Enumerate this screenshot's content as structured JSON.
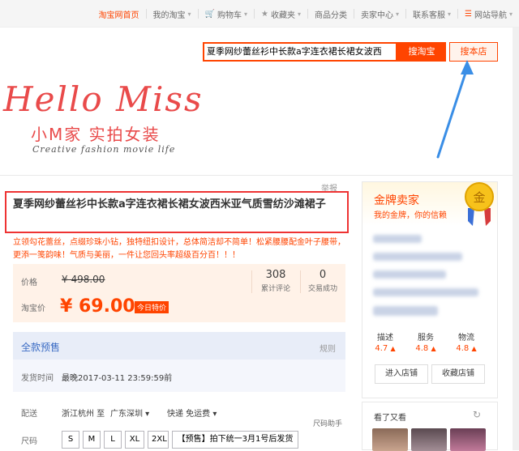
{
  "topnav": {
    "items": [
      {
        "label": "淘宝网首页",
        "icon": "",
        "dropdown": false,
        "home": true
      },
      {
        "label": "我的淘宝",
        "icon": "",
        "dropdown": true
      },
      {
        "label": "购物车",
        "icon": "cart-icon",
        "dropdown": true
      },
      {
        "label": "收藏夹",
        "icon": "star-icon",
        "dropdown": true
      },
      {
        "label": "商品分类",
        "icon": "",
        "dropdown": false
      },
      {
        "label": "卖家中心",
        "icon": "",
        "dropdown": true
      },
      {
        "label": "联系客服",
        "icon": "",
        "dropdown": true
      },
      {
        "label": "网站导航",
        "icon": "menu-icon",
        "dropdown": true
      }
    ]
  },
  "search": {
    "value": "夏季网纱蕾丝衫中长款a字连衣裙长裙女波西",
    "button_taobao": "搜淘宝",
    "button_shop": "搜本店"
  },
  "banner": {
    "title": "Hello Miss",
    "subtitle": "小M家 实拍女装",
    "tagline": "Creative fashion movie life"
  },
  "product": {
    "report": "举报",
    "title": "夏季网纱蕾丝衫中长款a字连衣裙长裙女波西米亚气质雪纺沙滩裙子",
    "subtitle": "立领勾花蕾丝，点缀珍珠小钻，独特纽扣设计，总体简洁却不简单！松紧腰腰配金叶子腰带，更添一笺韵味！气质与美丽，一件让您回头率超级百分百！！！",
    "price_label": "价格",
    "original_price": "¥ 498.00",
    "tb_price_label": "淘宝价",
    "tb_price": "¥ 69.00",
    "tag_today": "今日特价",
    "reviews_count": "308",
    "reviews_label": "累计评论",
    "sales_count": "0",
    "sales_label": "交易成功"
  },
  "presale": {
    "title": "全款预售",
    "rule_link": "规则",
    "time_label": "发货时间",
    "time_value": "最晚2017-03-11 23:59:59前"
  },
  "shipping": {
    "label": "配送",
    "from": "浙江杭州 至",
    "to": "广东深圳 ▾",
    "fee": "快递 免运费 ▾"
  },
  "size": {
    "help": "尺码助手",
    "label": "尺码",
    "options": [
      "S",
      "M",
      "L",
      "XL",
      "2XL",
      "【预售】拍下统一3月1号后发货"
    ]
  },
  "seller": {
    "title": "金牌卖家",
    "subtitle": "我的金牌，你的信赖",
    "medal_text": "金",
    "ratings": [
      {
        "label": "描述",
        "value": "4.7"
      },
      {
        "label": "服务",
        "value": "4.8"
      },
      {
        "label": "物流",
        "value": "4.8"
      }
    ],
    "btn_enter": "进入店铺",
    "btn_fav": "收藏店铺",
    "also_title": "看了又看",
    "refresh": "↻"
  },
  "colors": {
    "accent": "#ff4400",
    "title_box": "#e33333",
    "arrow": "#3a8ee6"
  }
}
